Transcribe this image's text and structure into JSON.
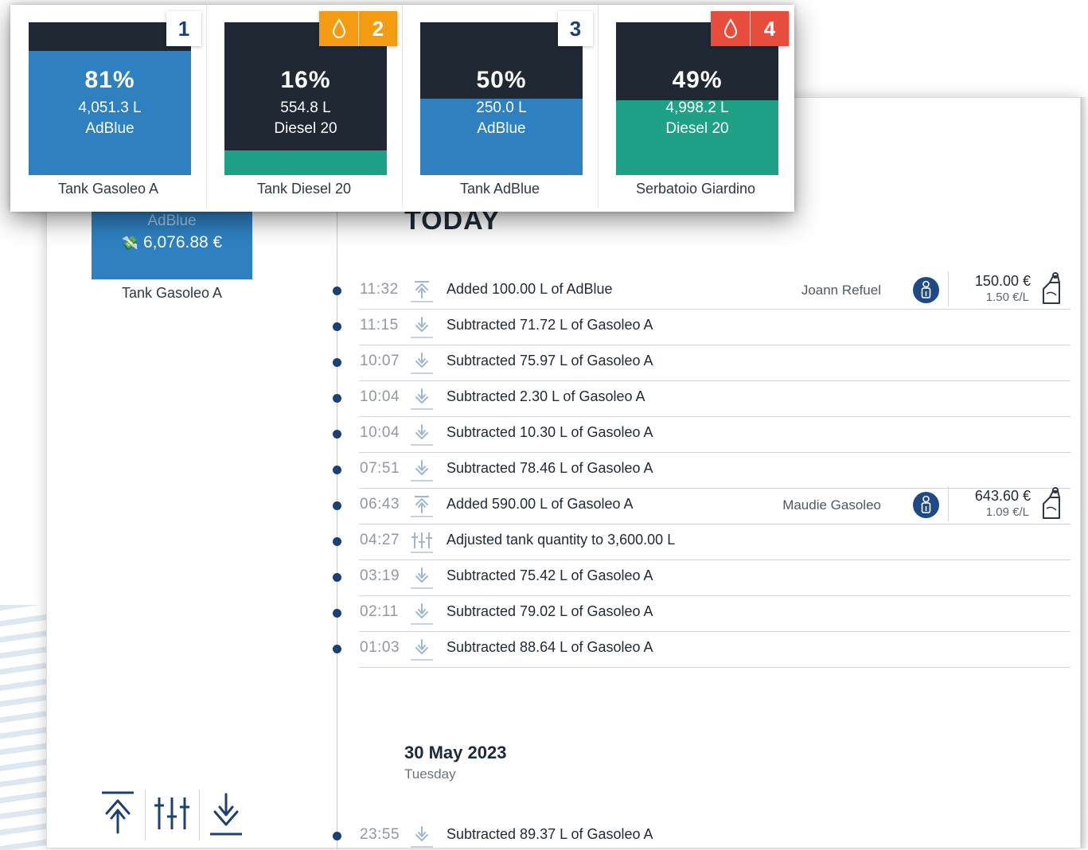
{
  "colors": {
    "navy": "#1f2833",
    "adblue": "#2e80c1",
    "diesel": "#1fa187",
    "accent": "#1d3f72",
    "warning": "#f39c12",
    "danger": "#e74c3c"
  },
  "tanks": [
    {
      "badge": "1",
      "percent": "81%",
      "fill": 0.81,
      "volume": "4,051.3 L",
      "fuel": "AdBlue",
      "name": "Tank Gasoleo A",
      "fill_color": "#2e80c1",
      "alert": "none"
    },
    {
      "badge": "2",
      "percent": "16%",
      "fill": 0.16,
      "volume": "554.8 L",
      "fuel": "Diesel 20",
      "name": "Tank Diesel 20",
      "fill_color": "#1fa187",
      "alert": "warning"
    },
    {
      "badge": "3",
      "percent": "50%",
      "fill": 0.5,
      "volume": "250.0 L",
      "fuel": "AdBlue",
      "name": "Tank AdBlue",
      "fill_color": "#2e80c1",
      "alert": "none"
    },
    {
      "badge": "4",
      "percent": "49%",
      "fill": 0.49,
      "volume": "4,998.2 L",
      "fuel": "Diesel 20",
      "name": "Serbatoio Giardino",
      "fill_color": "#1fa187",
      "alert": "danger"
    }
  ],
  "selected_tank": {
    "fuel": "AdBlue",
    "value": "6,076.88 €",
    "name": "Tank Gasoleo A",
    "value_icon": "money-icon"
  },
  "timeline": {
    "today_label": "TODAY",
    "today": [
      {
        "time": "11:32",
        "type": "add",
        "icon": "add-icon",
        "text": "Added 100.00 L of AdBlue",
        "user": "Joann Refuel",
        "price": "150.00 €",
        "ppl": "1.50 €/L"
      },
      {
        "time": "11:15",
        "type": "subtract",
        "icon": "subtract-icon",
        "text": "Subtracted 71.72 L of Gasoleo A"
      },
      {
        "time": "10:07",
        "type": "subtract",
        "icon": "subtract-icon",
        "text": "Subtracted 75.97 L of Gasoleo A"
      },
      {
        "time": "10:04",
        "type": "subtract",
        "icon": "subtract-icon",
        "text": "Subtracted 2.30 L of Gasoleo A"
      },
      {
        "time": "10:04",
        "type": "subtract",
        "icon": "subtract-icon",
        "text": "Subtracted 10.30 L of Gasoleo A"
      },
      {
        "time": "07:51",
        "type": "subtract",
        "icon": "subtract-icon",
        "text": "Subtracted 78.46 L of Gasoleo A"
      },
      {
        "time": "06:43",
        "type": "add",
        "icon": "add-icon",
        "text": "Added 590.00 L of Gasoleo A",
        "user": "Maudie Gasoleo",
        "price": "643.60 €",
        "ppl": "1.09 €/L"
      },
      {
        "time": "04:27",
        "type": "adjust",
        "icon": "adjust-icon",
        "text": "Adjusted tank quantity to 3,600.00 L"
      },
      {
        "time": "03:19",
        "type": "subtract",
        "icon": "subtract-icon",
        "text": "Subtracted 75.42 L of Gasoleo A"
      },
      {
        "time": "02:11",
        "type": "subtract",
        "icon": "subtract-icon",
        "text": "Subtracted 79.02 L of Gasoleo A"
      },
      {
        "time": "01:03",
        "type": "subtract",
        "icon": "subtract-icon",
        "text": "Subtracted 88.64 L of Gasoleo A"
      }
    ],
    "previous_date": "30 May 2023",
    "previous_weekday": "Tuesday",
    "previous": [
      {
        "time": "23:55",
        "type": "subtract",
        "icon": "subtract-icon",
        "text": "Subtracted 89.37 L of Gasoleo A"
      }
    ]
  },
  "actions": {
    "icons": [
      "add-icon",
      "adjust-icon",
      "subtract-icon"
    ]
  }
}
